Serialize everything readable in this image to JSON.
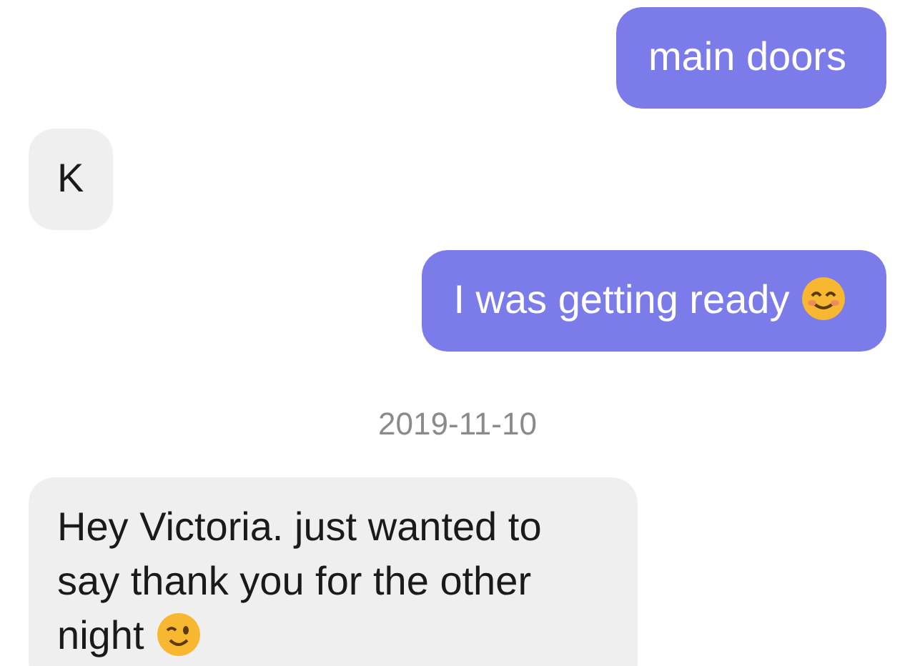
{
  "messages": [
    {
      "kind": "sent",
      "text": "main doors"
    },
    {
      "kind": "received",
      "text": "K"
    },
    {
      "kind": "sent",
      "text": "I was getting ready"
    },
    {
      "kind": "date",
      "text": "2019-11-10"
    },
    {
      "kind": "received",
      "text": "Hey Victoria. just wanted to say thank you for the other night"
    }
  ]
}
